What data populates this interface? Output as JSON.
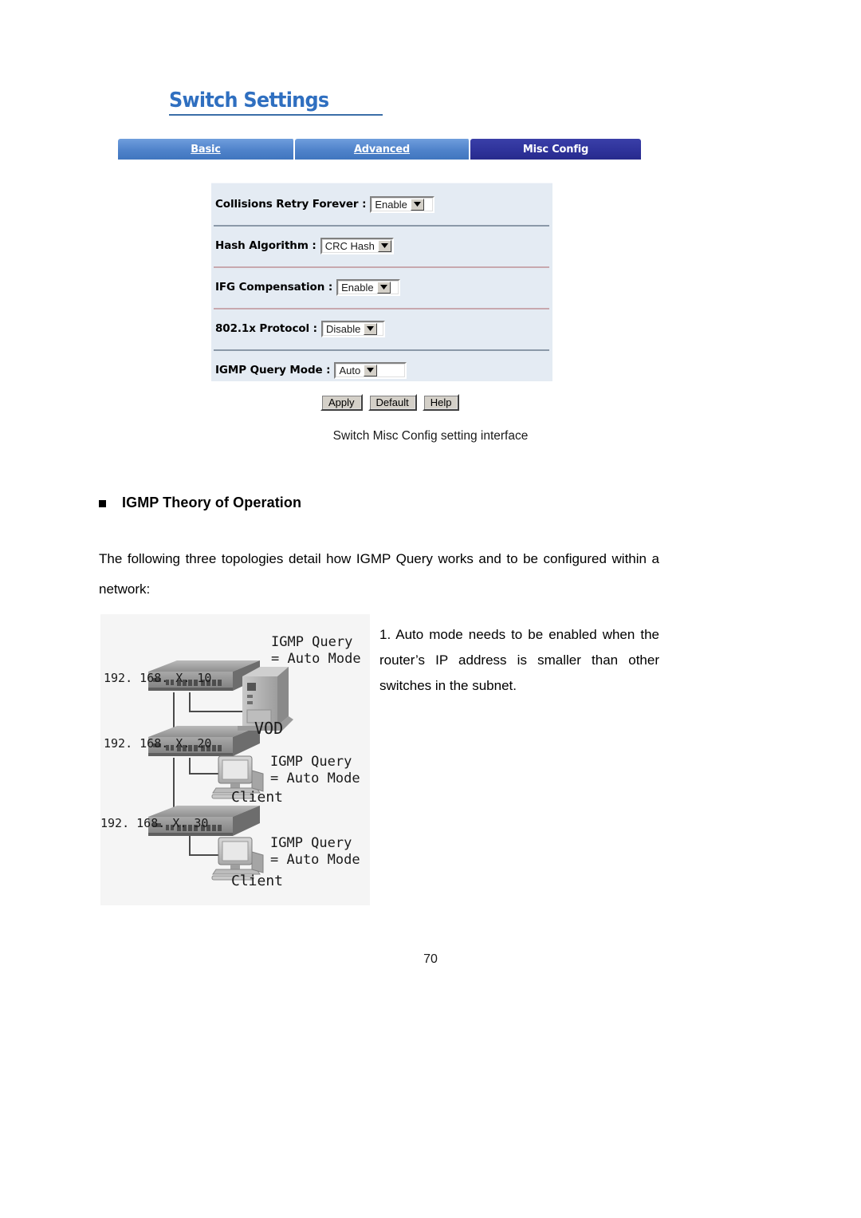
{
  "page": {
    "number": "70"
  },
  "screenshot_figure": {
    "panel_title": "Switch Settings",
    "tabs": [
      {
        "label": "Basic",
        "active": false
      },
      {
        "label": "Advanced",
        "active": false
      },
      {
        "label": "Misc Config",
        "active": true
      }
    ],
    "fields": [
      {
        "label": "Collisions Retry Forever :",
        "value": "Enable"
      },
      {
        "label": "Hash Algorithm :",
        "value": "CRC Hash"
      },
      {
        "label": "IFG Compensation :",
        "value": "Enable"
      },
      {
        "label": "802.1x Protocol :",
        "value": "Disable"
      },
      {
        "label": "IGMP Query Mode :",
        "value": "Auto"
      }
    ],
    "buttons": [
      {
        "label": "Apply"
      },
      {
        "label": "Default"
      },
      {
        "label": "Help"
      }
    ],
    "caption": "Switch Misc Config setting interface",
    "colors": {
      "title_blue": "#2f6fc0",
      "tab_inactive": "#4f82ca",
      "tab_active": "#2f339b",
      "panel_bg": "#e4ebf3"
    }
  },
  "section": {
    "bullet": "square-bullet",
    "heading": "IGMP Theory of Operation",
    "intro_paragraph": "The following three topologies detail how IGMP Query works and to be configured within a network:"
  },
  "topology_figure": {
    "note_number": "1.",
    "note_text": "1. Auto mode needs to be enabled when the router’s IP address is smaller than other switches in the subnet.",
    "ip_labels": [
      "192. 168. X. 10",
      "192. 168. X. 20",
      "192. 168. X. 30"
    ],
    "annotations": [
      {
        "line1": "IGMP Query",
        "line2": "= Auto Mode"
      },
      {
        "line1": "IGMP Query",
        "line2": "= Auto Mode"
      },
      {
        "line1": "IGMP Query",
        "line2": "= Auto Mode"
      }
    ],
    "device_labels": {
      "server": "VOD",
      "client_upper": "Client",
      "client_lower": "Client"
    }
  }
}
